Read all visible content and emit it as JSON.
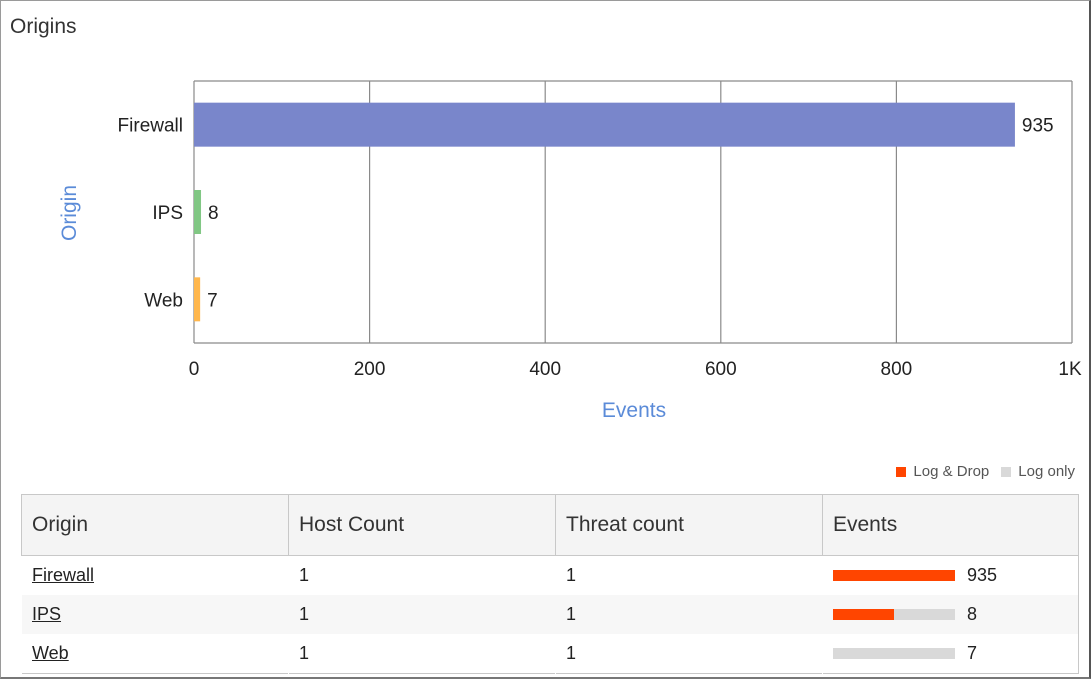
{
  "panel": {
    "title": "Origins"
  },
  "colors": {
    "log_drop": "#ff4500",
    "log_only": "#d9d9d9",
    "axis_title": "#5b8bd8"
  },
  "chart_data": {
    "type": "bar",
    "orientation": "horizontal",
    "categories": [
      "Firewall",
      "IPS",
      "Web"
    ],
    "values": [
      935,
      8,
      7
    ],
    "bar_colors": [
      "#7986cb",
      "#81c784",
      "#ffb74d"
    ],
    "xlabel": "Events",
    "ylabel": "Origin",
    "xlim": [
      0,
      1000
    ],
    "xticks": [
      "0",
      "200",
      "400",
      "600",
      "800",
      "1K"
    ],
    "grid": true
  },
  "legend": {
    "items": [
      {
        "label": "Log & Drop",
        "color": "#ff4500"
      },
      {
        "label": "Log only",
        "color": "#d9d9d9"
      }
    ]
  },
  "table": {
    "headers": [
      "Origin",
      "Host Count",
      "Threat count",
      "Events"
    ],
    "rows": [
      {
        "origin": "Firewall",
        "host_count": "1",
        "threat_count": "1",
        "events": "935",
        "log_drop_fraction": 1.0
      },
      {
        "origin": "IPS",
        "host_count": "1",
        "threat_count": "1",
        "events": "8",
        "log_drop_fraction": 0.5
      },
      {
        "origin": "Web",
        "host_count": "1",
        "threat_count": "1",
        "events": "7",
        "log_drop_fraction": 0.0
      }
    ]
  }
}
